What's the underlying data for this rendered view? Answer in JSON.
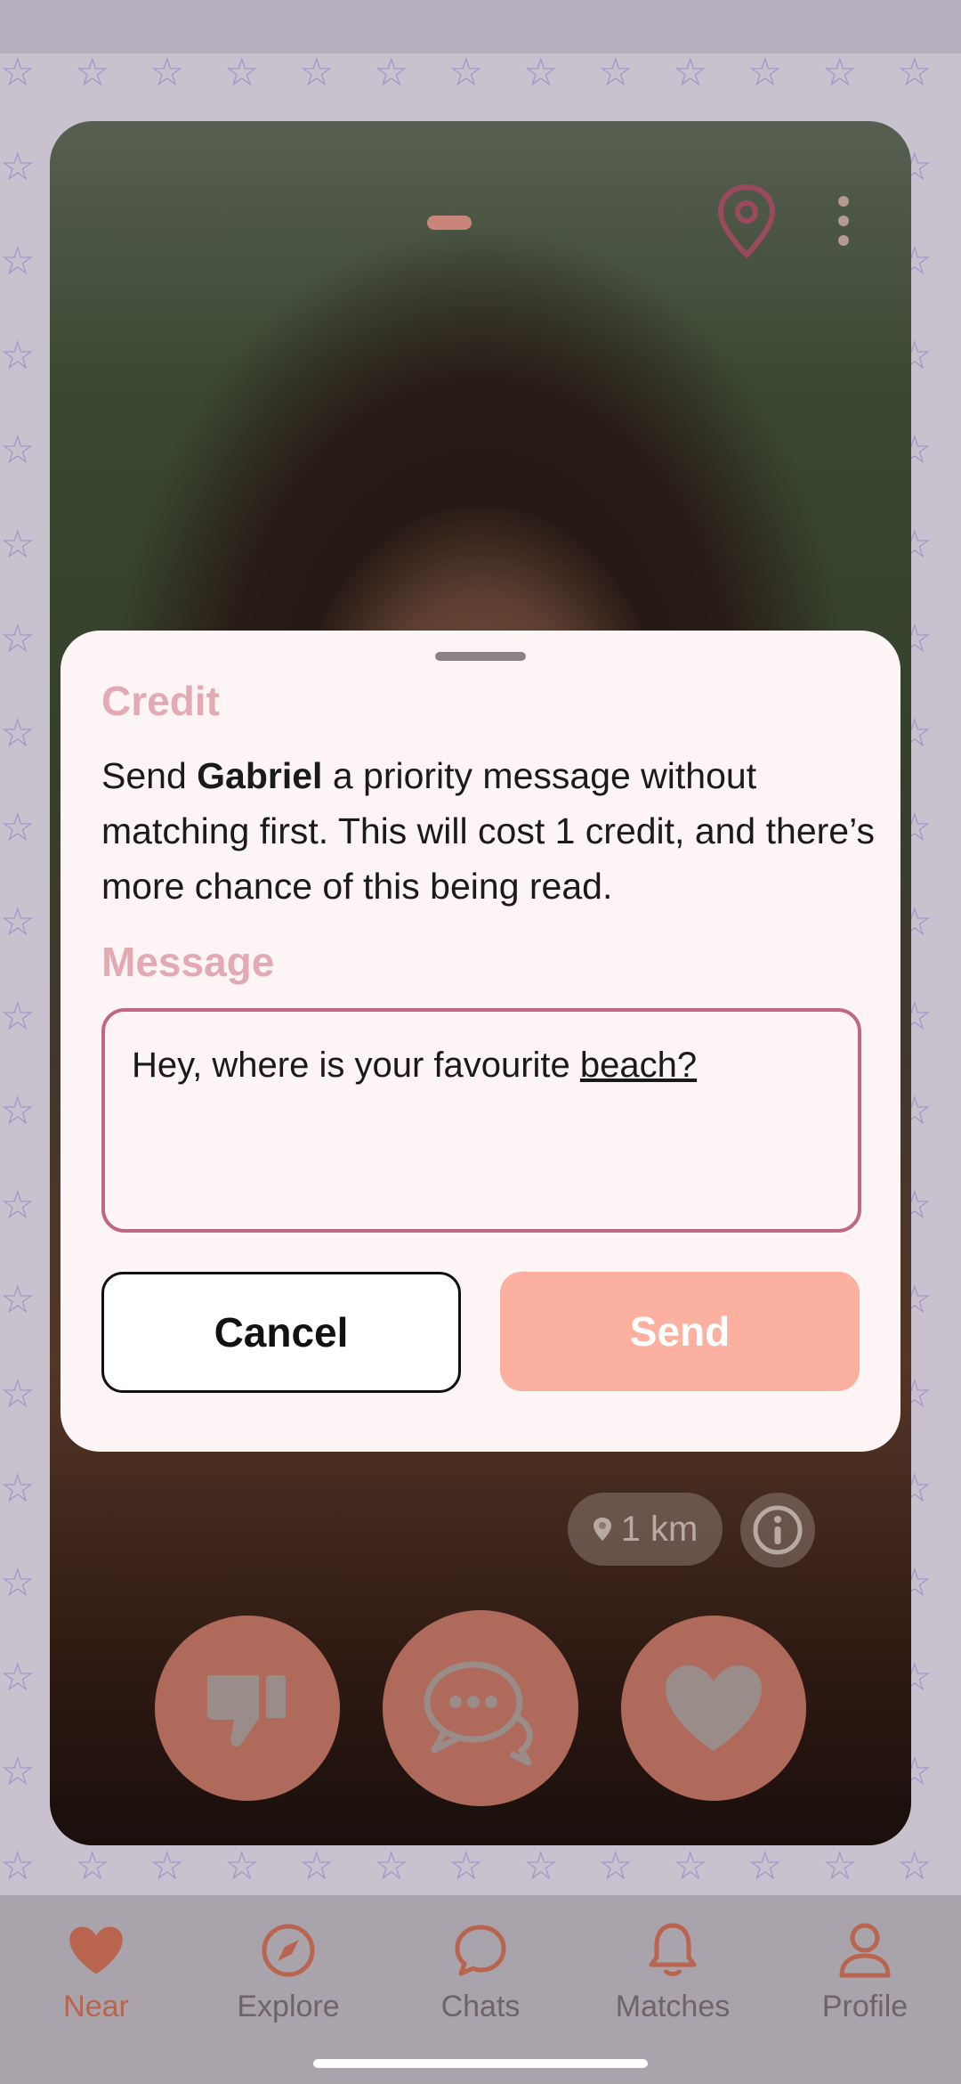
{
  "card": {
    "distance_label": "1 km"
  },
  "sheet": {
    "credit_heading": "Credit",
    "credit_text_before": "Send ",
    "credit_name": "Gabriel",
    "credit_text_after": " a priority message without matching first. This will cost 1 credit, and there’s more chance of this being read.",
    "message_heading": "Message",
    "message_value_prefix": "Hey, where is your favourite ",
    "message_value_underlined": "beach?",
    "cancel_label": "Cancel",
    "send_label": "Send"
  },
  "nav": {
    "items": [
      {
        "label": "Near",
        "icon": "heart-icon",
        "active": true
      },
      {
        "label": "Explore",
        "icon": "compass-icon",
        "active": false
      },
      {
        "label": "Chats",
        "icon": "chat-bubble-icon",
        "active": false
      },
      {
        "label": "Matches",
        "icon": "bell-icon",
        "active": false
      },
      {
        "label": "Profile",
        "icon": "person-icon",
        "active": false
      }
    ]
  },
  "colors": {
    "accent": "#b8644f",
    "send_button": "#fbb0a0",
    "message_border": "#c06785",
    "section_label": "#e3aab4"
  }
}
